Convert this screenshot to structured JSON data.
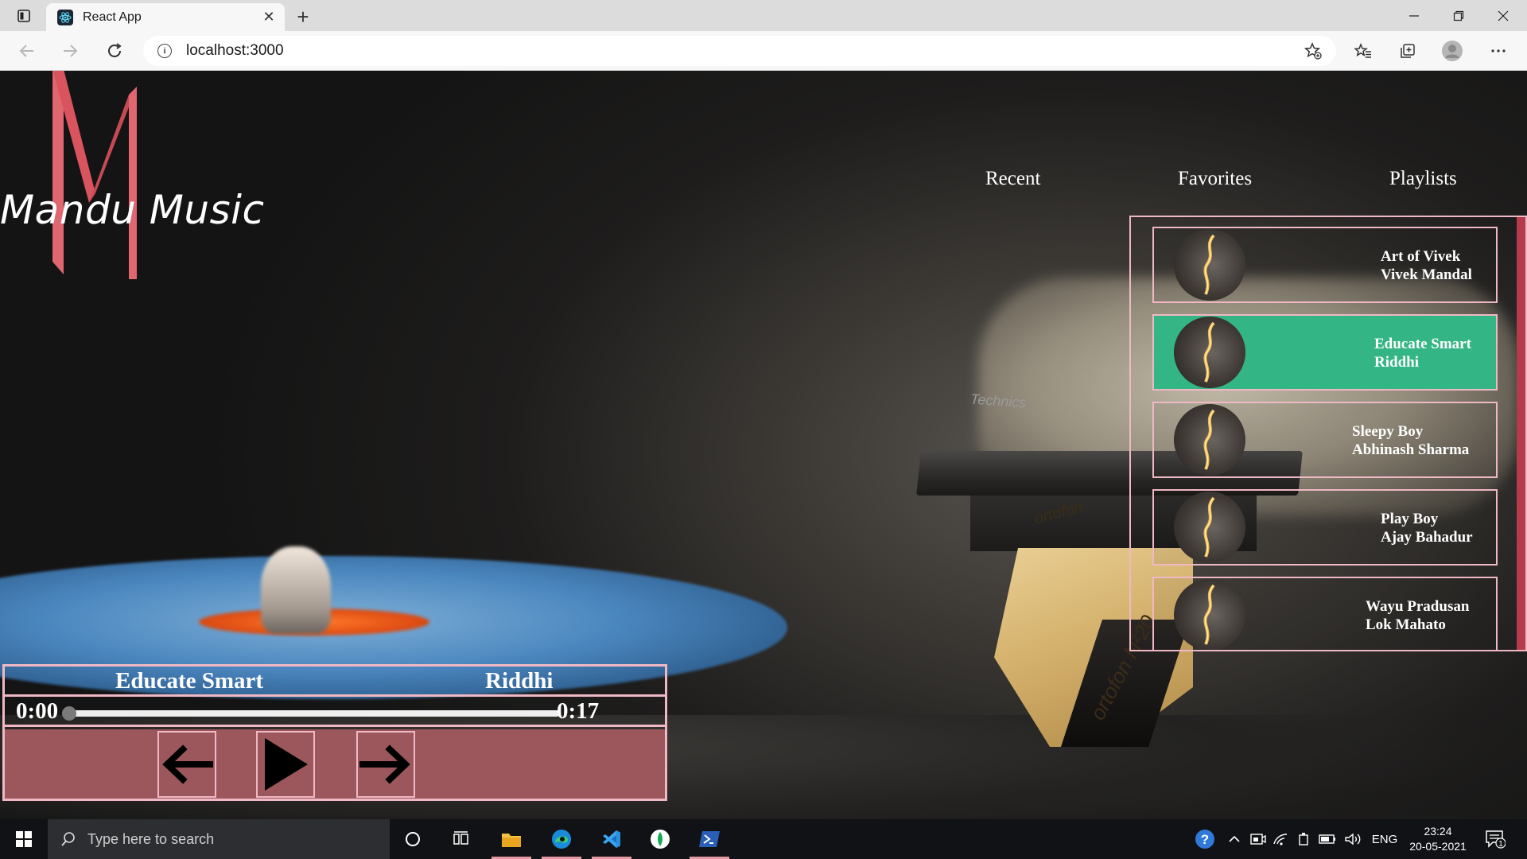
{
  "browser": {
    "tab_title": "React App",
    "url": "localhost:3000"
  },
  "app": {
    "logo_letter": "M",
    "title": "Mandu Music",
    "nav": [
      "Recent",
      "Favorites",
      "Playlists"
    ],
    "songs": [
      {
        "title": "Art of Vivek",
        "artist": "Vivek Mandal",
        "active": false
      },
      {
        "title": "Educate Smart",
        "artist": "Riddhi",
        "active": true
      },
      {
        "title": "Sleepy Boy",
        "artist": "Abhinash Sharma",
        "active": false
      },
      {
        "title": "Play Boy",
        "artist": "Ajay Bahadur",
        "active": false
      },
      {
        "title": "Wayu Pradusan",
        "artist": "Lok Mahato",
        "active": false
      }
    ],
    "player": {
      "song": "Educate Smart",
      "artist": "Riddhi",
      "current_time": "0:00",
      "duration": "0:17",
      "progress_fraction": 0.0,
      "controls": {
        "prev": "arrow-left-icon",
        "play": "play-icon",
        "next": "arrow-right-icon"
      }
    },
    "colors": {
      "accent_pink": "#f0b8c4",
      "active_song": "#34b585",
      "controls_bg": "#9c575d",
      "logo_red": "#e06070"
    },
    "background_brand_marks": [
      "Technics",
      "ortofon",
      "ortofon N²20"
    ]
  },
  "taskbar": {
    "search_placeholder": "Type here to search",
    "language": "ENG",
    "time": "23:24",
    "date": "20-05-2021",
    "notification_count": "1"
  }
}
